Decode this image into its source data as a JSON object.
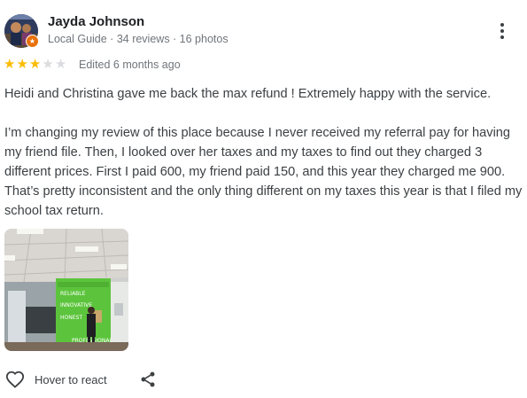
{
  "review": {
    "author_name": "Jayda Johnson",
    "author_meta": "Local Guide · 34 reviews · 16 photos",
    "rating": 3,
    "rating_max": 5,
    "star_color_filled": "#fbbc04",
    "star_color_empty": "#dadce0",
    "edited_label": "Edited 6 months ago",
    "paragraphs": [
      "Heidi and Christina gave me back the max refund ! Extremely happy with the service.",
      "I’m changing my review of this place because I never received my referral pay for having my friend file. Then, I looked over her taxes and my taxes to find out they charged 3 different prices. First I paid 600, my friend paid 150, and this year they charged me 900. That’s pretty inconsistent and the only thing different on my taxes this year is that I filed my school tax return."
    ],
    "photo_wall_words": [
      "RELIABLE",
      "INNOVATIVE",
      "HONEST",
      "PROFESSIONAL"
    ]
  },
  "actions": {
    "react_label": "Hover to react",
    "react_icon": "heart-outline-icon",
    "share_icon": "share-icon",
    "more_icon": "more-vertical-icon"
  },
  "badge": {
    "icon": "local-guide-star-icon",
    "color": "#e8710a"
  }
}
